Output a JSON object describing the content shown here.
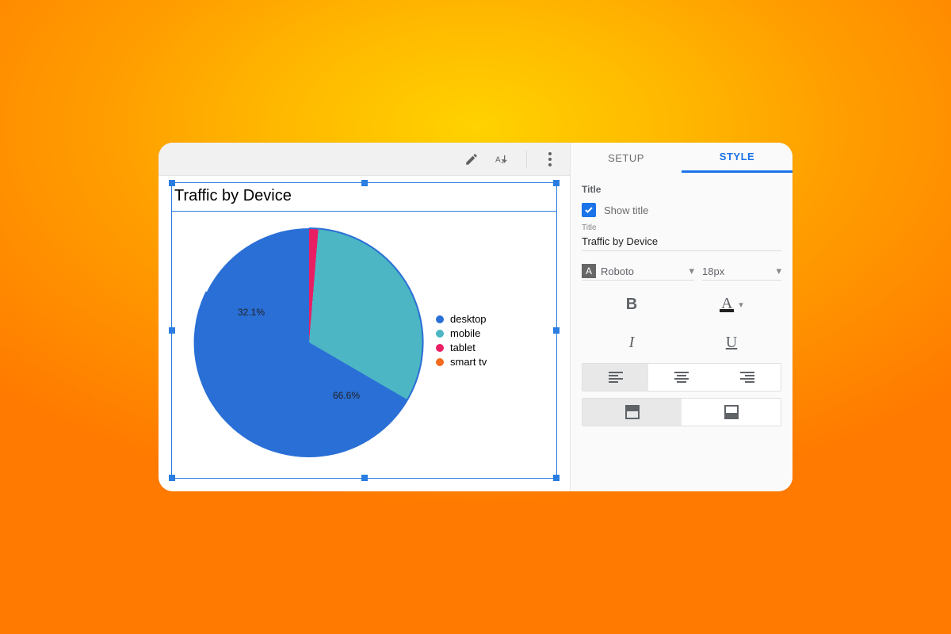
{
  "chart_data": {
    "type": "pie",
    "title": "Traffic by Device",
    "series": [
      {
        "name": "desktop",
        "value": 66.6,
        "color": "#2a6fd6"
      },
      {
        "name": "mobile",
        "value": 32.1,
        "color": "#4cb6c4"
      },
      {
        "name": "tablet",
        "value": 1.3,
        "color": "#e91e63"
      },
      {
        "name": "smart tv",
        "value": 0.0,
        "color": "#f46b1f"
      }
    ],
    "labels_shown": [
      "66.6%",
      "32.1%"
    ]
  },
  "canvas": {
    "chart_title": "Traffic by Device",
    "labels": {
      "big": "66.6%",
      "small": "32.1%"
    },
    "legend": [
      {
        "label": "desktop",
        "color": "#2a6fd6"
      },
      {
        "label": "mobile",
        "color": "#4cb6c4"
      },
      {
        "label": "tablet",
        "color": "#e91e63"
      },
      {
        "label": "smart tv",
        "color": "#f46b1f"
      }
    ]
  },
  "panel": {
    "tabs": {
      "setup": "SETUP",
      "style": "STYLE"
    },
    "title_section_label": "Title",
    "show_title_label": "Show title",
    "title_field_label": "Title",
    "title_value": "Traffic by Device",
    "font_family": "Roboto",
    "font_size": "18px",
    "bold": "B",
    "italic": "I",
    "underline": "U"
  }
}
